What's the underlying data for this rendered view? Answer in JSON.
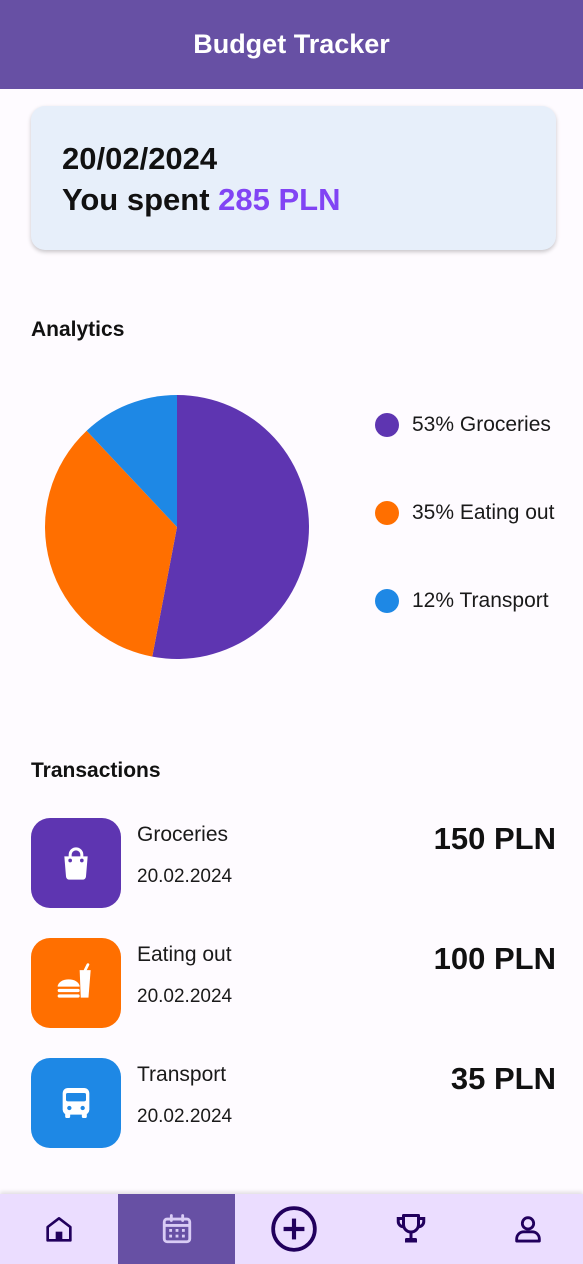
{
  "app": {
    "title": "Budget Tracker"
  },
  "summary": {
    "date": "20/02/2024",
    "spent_prefix": "You spent ",
    "spent_amount": "285 PLN"
  },
  "analytics": {
    "title": "Analytics",
    "legend": [
      {
        "label": "53% Groceries",
        "color": "#5e35b1"
      },
      {
        "label": "35% Eating out",
        "color": "#ff6f00"
      },
      {
        "label": "12% Transport",
        "color": "#1e88e5"
      }
    ]
  },
  "chart_data": {
    "type": "pie",
    "categories": [
      "Groceries",
      "Eating out",
      "Transport"
    ],
    "values": [
      53,
      35,
      12
    ],
    "colors": [
      "#5e35b1",
      "#ff6f00",
      "#1e88e5"
    ]
  },
  "transactions": {
    "title": "Transactions",
    "items": [
      {
        "name": "Groceries",
        "date": "20.02.2024",
        "amount": "150 PLN",
        "icon": "shopping-bag-icon",
        "color": "#5e35b1"
      },
      {
        "name": "Eating out",
        "date": "20.02.2024",
        "amount": "100 PLN",
        "icon": "fast-food-icon",
        "color": "#ff6f00"
      },
      {
        "name": "Transport",
        "date": "20.02.2024",
        "amount": "35 PLN",
        "icon": "bus-icon",
        "color": "#1e88e5"
      }
    ]
  },
  "nav": {
    "items": [
      {
        "icon": "home-icon",
        "active": false
      },
      {
        "icon": "calendar-icon",
        "active": true
      },
      {
        "icon": "add-circle-icon",
        "active": false
      },
      {
        "icon": "trophy-icon",
        "active": false
      },
      {
        "icon": "profile-icon",
        "active": false
      }
    ]
  }
}
